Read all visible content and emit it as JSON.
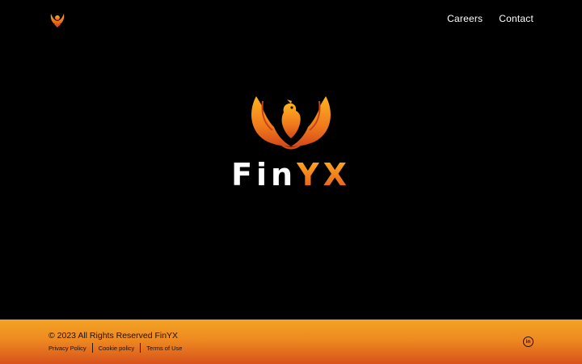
{
  "header": {
    "logo_icon": "phoenix-icon",
    "nav": [
      {
        "label": "Careers"
      },
      {
        "label": "Contact"
      }
    ]
  },
  "hero": {
    "logo_icon": "phoenix-icon",
    "brand_part1": "Fin",
    "brand_part2": "YX"
  },
  "footer": {
    "copyright": "© 2023 All Rights Reserved FinYX",
    "links": [
      {
        "label": "Privacy Policy"
      },
      {
        "label": "Cookie policy"
      },
      {
        "label": "Terms of Use"
      }
    ],
    "social_icon": "linkedin-icon",
    "social_text": "in"
  },
  "colors": {
    "background": "#000000",
    "accent_orange": "#ee8a20",
    "accent_red": "#d8521c",
    "accent_yellow": "#f2a324"
  }
}
